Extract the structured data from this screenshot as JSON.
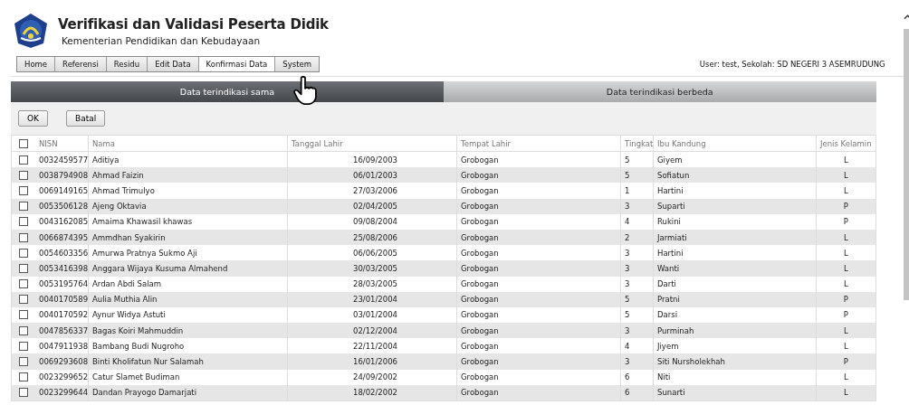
{
  "header": {
    "title": "Verifikasi dan Validasi Peserta Didik",
    "subtitle": "Kementerian Pendidikan dan Kebudayaan"
  },
  "menu": [
    {
      "label": "Home",
      "selected": false
    },
    {
      "label": "Referensi",
      "selected": false
    },
    {
      "label": "Residu",
      "selected": false
    },
    {
      "label": "Edit Data",
      "selected": false
    },
    {
      "label": "Konfirmasi Data",
      "selected": true
    },
    {
      "label": "System",
      "selected": false
    }
  ],
  "user_info": "User: test, Sekolah: SD NEGERI 3 ASEMRUDUNG",
  "tabs": [
    {
      "label": "Data terindikasi sama",
      "selected": true
    },
    {
      "label": "Data terindikasi berbeda",
      "selected": false
    }
  ],
  "buttons": [
    "OK",
    "Batal"
  ],
  "table": {
    "select_all_checked": false,
    "columns": [
      "NISN",
      "Nama",
      "Tanggal Lahir",
      "Tempat Lahir",
      "Tingkat",
      "Ibu Kandung",
      "Jenis Kelamin"
    ],
    "rows": [
      {
        "checked": false,
        "cells": [
          "0032459577",
          "Aditiya",
          "16/09/2003",
          "Grobogan",
          "5",
          "Giyem",
          "L"
        ]
      },
      {
        "checked": false,
        "cells": [
          "0038794908",
          "Ahmad Faizin",
          "06/01/2003",
          "Grobogan",
          "5",
          "Sofiatun",
          "L"
        ]
      },
      {
        "checked": false,
        "cells": [
          "0069149165",
          "Ahmad Trimulyo",
          "27/03/2006",
          "Grobogan",
          "1",
          "Hartini",
          "L"
        ]
      },
      {
        "checked": false,
        "cells": [
          "0053506128",
          "Ajeng Oktavia",
          "02/04/2005",
          "Grobogan",
          "3",
          "Suparti",
          "P"
        ]
      },
      {
        "checked": false,
        "cells": [
          "0043162085",
          "Amaima Khawasil khawas",
          "09/08/2004",
          "Grobogan",
          "4",
          "Rukini",
          "P"
        ]
      },
      {
        "checked": false,
        "cells": [
          "0066874395",
          "Ammdhan Syakirin",
          "25/08/2006",
          "Grobogan",
          "2",
          "Jarmiati",
          "L"
        ]
      },
      {
        "checked": false,
        "cells": [
          "0054603356",
          "Amurwa Pratnya Sukmo Aji",
          "06/06/2005",
          "Grobogan",
          "3",
          "Hartini",
          "L"
        ]
      },
      {
        "checked": false,
        "cells": [
          "0053416398",
          "Anggara Wijaya Kusuma Almahend",
          "30/03/2005",
          "Grobogan",
          "3",
          "Wanti",
          "L"
        ]
      },
      {
        "checked": false,
        "cells": [
          "0053195764",
          "Ardan Abdi Salam",
          "28/03/2005",
          "Grobogan",
          "3",
          "Darti",
          "L"
        ]
      },
      {
        "checked": false,
        "cells": [
          "0040170589",
          "Aulia Muthia Alin",
          "23/01/2004",
          "Grobogan",
          "5",
          "Pratni",
          "P"
        ]
      },
      {
        "checked": false,
        "cells": [
          "0040170592",
          "Aynur Widya Astuti",
          "03/01/2004",
          "Grobogan",
          "5",
          "Darsi",
          "P"
        ]
      },
      {
        "checked": false,
        "cells": [
          "0047856337",
          "Bagas Koiri Mahmuddin",
          "02/12/2004",
          "Grobogan",
          "3",
          "Purminah",
          "L"
        ]
      },
      {
        "checked": false,
        "cells": [
          "0047911938",
          "Bambang Budi Nugroho",
          "22/11/2004",
          "Grobogan",
          "4",
          "Jiyem",
          "L"
        ]
      },
      {
        "checked": false,
        "cells": [
          "0069293608",
          "Binti Kholifatun Nur Salamah",
          "16/01/2006",
          "Grobogan",
          "3",
          "Siti Nursholekhah",
          "P"
        ]
      },
      {
        "checked": false,
        "cells": [
          "0023299652",
          "Catur Slamet Budiman",
          "24/09/2002",
          "Grobogan",
          "6",
          "Niti",
          "L"
        ]
      },
      {
        "checked": false,
        "cells": [
          "0023299644",
          "Dandan Prayogo Damarjati",
          "18/02/2002",
          "Grobogan",
          "6",
          "Sunarti",
          "L"
        ]
      }
    ]
  }
}
